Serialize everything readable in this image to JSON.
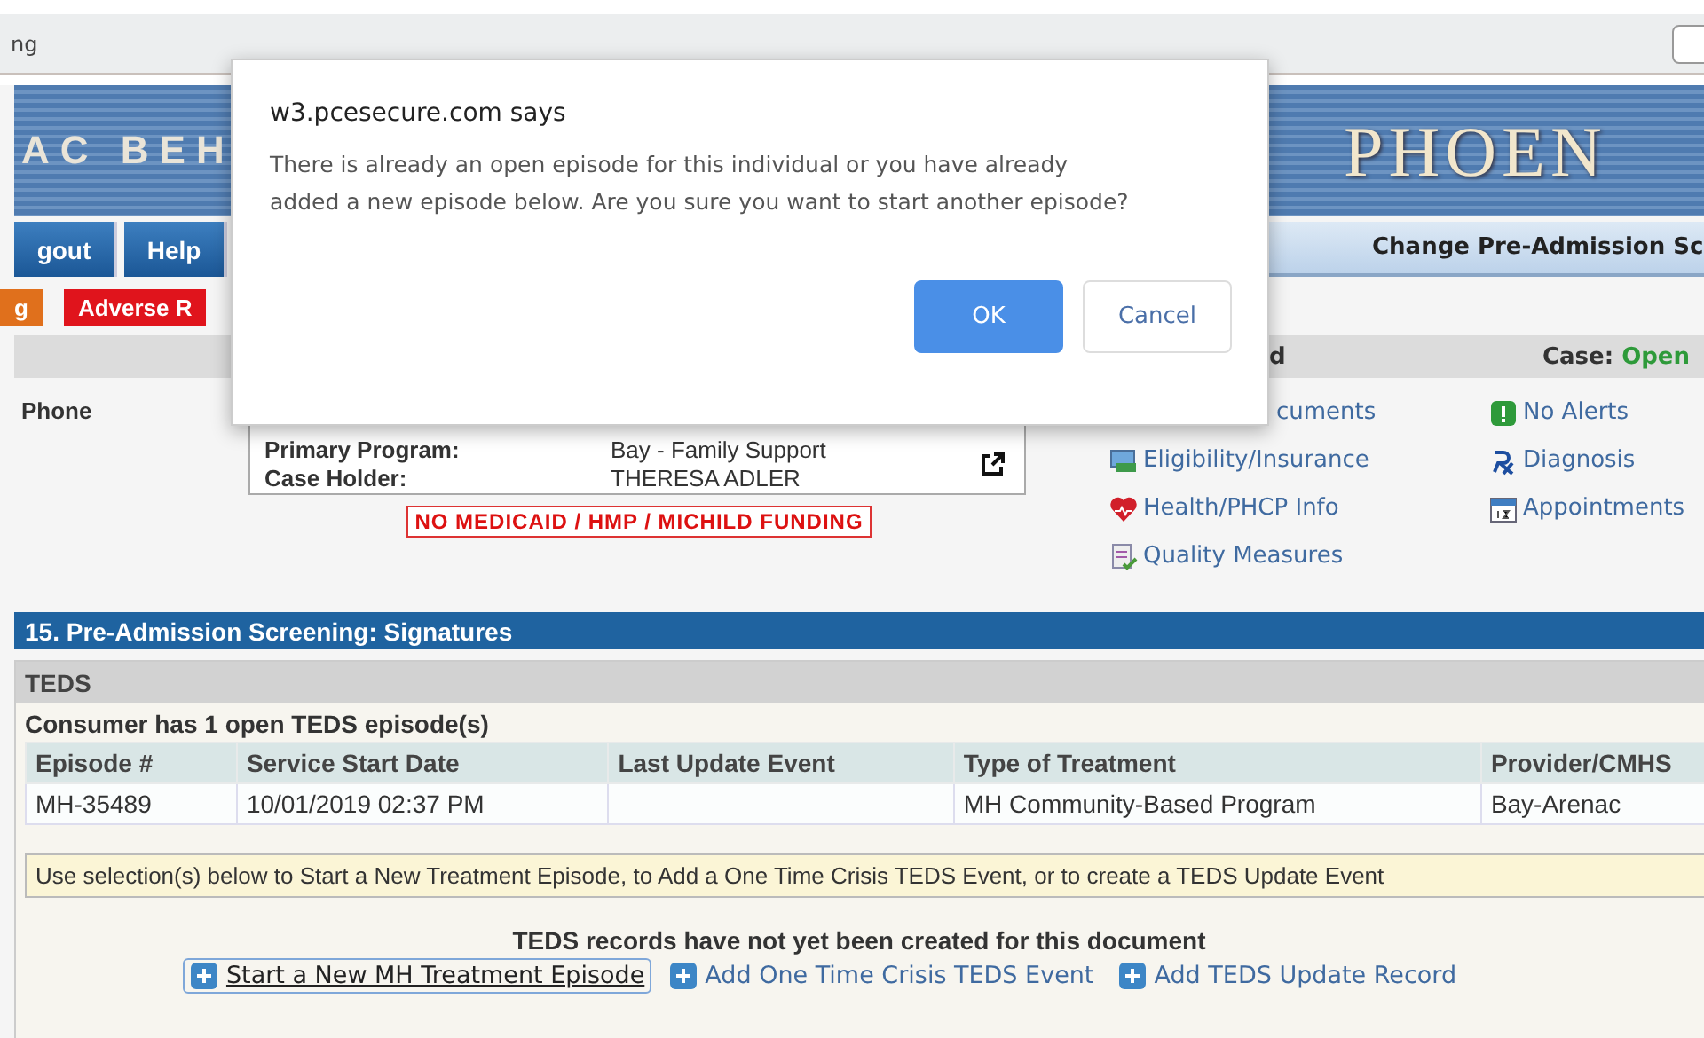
{
  "browser_bar": {
    "text": "ng"
  },
  "banner": {
    "left_title": "AC BEH",
    "right_title": "PHOEN"
  },
  "nav": {
    "buttons": [
      "gout",
      "Help"
    ],
    "page_title": "Change Pre-Admission Sc"
  },
  "tags": [
    {
      "label": "g",
      "color": "#e0701c"
    },
    {
      "label": "Adverse R",
      "color": "#e0141c"
    }
  ],
  "case_bar": {
    "label": "d",
    "status_label": "Case:",
    "status": "Open"
  },
  "left_label": "Phone",
  "info_box": {
    "rows": [
      {
        "label": "Primary Program:",
        "value": "Bay - Family Support"
      },
      {
        "label": "Case Holder:",
        "value": "THERESA ADLER"
      }
    ]
  },
  "funding_warning": "NO MEDICAID / HMP / MICHILD FUNDING",
  "links_left": [
    {
      "label": "cuments",
      "kind": "none"
    },
    {
      "label": "Eligibility/Insurance",
      "kind": "eligibility"
    },
    {
      "label": "Health/PHCP Info",
      "kind": "health"
    },
    {
      "label": "Quality Measures",
      "kind": "quality"
    }
  ],
  "links_right": [
    {
      "label": "No Alerts",
      "kind": "alert"
    },
    {
      "label": "Diagnosis",
      "kind": "diagnosis"
    },
    {
      "label": "Appointments",
      "kind": "calendar"
    }
  ],
  "section": {
    "title": "15. Pre-Admission Screening: Signatures",
    "subtitle": "TEDS",
    "note": "Consumer has 1 open TEDS episode(s)",
    "table": {
      "columns": [
        "Episode #",
        "Service Start Date",
        "Last Update Event",
        "Type of Treatment",
        "Provider/CMHS"
      ],
      "rows": [
        [
          "MH-35489",
          "10/01/2019 02:37 PM",
          "",
          "MH Community-Based Program",
          "Bay-Arenac"
        ]
      ]
    },
    "instruction": "Use selection(s) below to Start a New Treatment Episode, to Add a One Time Crisis TEDS Event, or to create a TEDS Update Event",
    "status": "TEDS records have not yet been created for this document",
    "actions": [
      {
        "label": "Start a New MH Treatment Episode",
        "focused": true
      },
      {
        "label": "Add One Time Crisis TEDS Event",
        "focused": false
      },
      {
        "label": "Add TEDS Update Record",
        "focused": false
      }
    ]
  },
  "dialog": {
    "origin": "w3.pcesecure.com says",
    "message": "There is already an open episode for this individual or you have already added a new episode below. Are you sure you want to start another episode?",
    "buttons": [
      {
        "label": "OK",
        "primary": true
      },
      {
        "label": "Cancel",
        "primary": false
      }
    ]
  }
}
